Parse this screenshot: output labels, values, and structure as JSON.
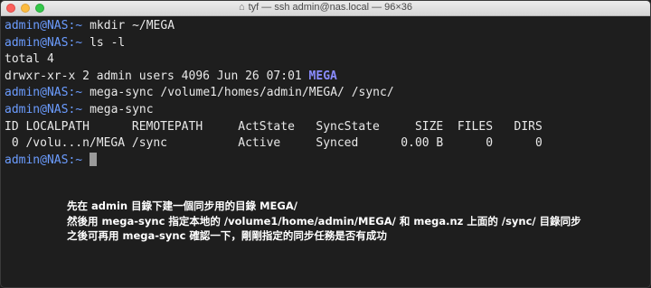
{
  "window": {
    "title": "tyf — ssh admin@nas.local — 96×36"
  },
  "terminal": {
    "prompt_user": "admin@NAS:",
    "prompt_path": "~",
    "lines": [
      {
        "type": "prompt",
        "cmd": "mkdir ~/MEGA"
      },
      {
        "type": "prompt",
        "cmd": "ls -l"
      },
      {
        "type": "out",
        "text": "total 4"
      },
      {
        "type": "lsrow",
        "text": "drwxr-xr-x 2 admin users 4096 Jun 26 07:01 ",
        "dir": "MEGA"
      },
      {
        "type": "prompt",
        "cmd": "mega-sync /volume1/homes/admin/MEGA/ /sync/"
      },
      {
        "type": "prompt",
        "cmd": "mega-sync"
      },
      {
        "type": "out",
        "text": "ID LOCALPATH      REMOTEPATH     ActState   SyncState     SIZE  FILES   DIRS"
      },
      {
        "type": "out",
        "text": " 0 /volu...n/MEGA /sync          Active     Synced      0.00 B      0      0"
      },
      {
        "type": "prompt",
        "cmd": ""
      }
    ]
  },
  "note": {
    "lines": [
      "先在 admin 目錄下建一個同步用的目錄 MEGA/",
      "然後用 mega-sync 指定本地的 /volume1/home/admin/MEGA/ 和 mega.nz 上面的 /sync/ 目錄同步",
      "之後可再用 mega-sync 確認一下，剛剛指定的同步任務是否有成功"
    ]
  },
  "colors": {
    "background": "#1e1e1e",
    "prompt": "#6b9cff",
    "directory": "#8a8cff",
    "text": "#e8e8e8"
  }
}
